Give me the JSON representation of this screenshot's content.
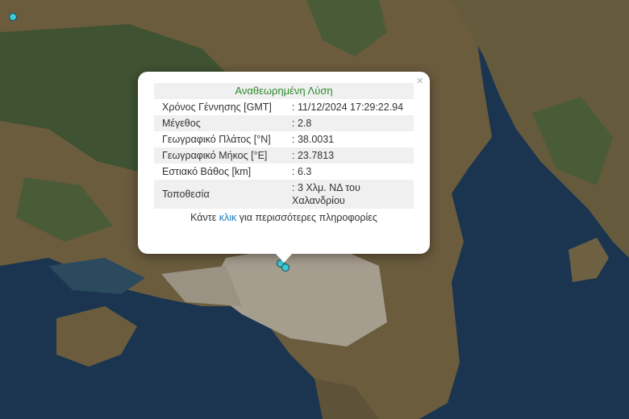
{
  "popup": {
    "heading": "Αναθεωρημένη Λύση",
    "close_label": "×",
    "rows": [
      {
        "label": "Χρόνος Γέννησης [GMT]",
        "value": ": 11/12/2024 17:29:22.94"
      },
      {
        "label": "Μέγεθος",
        "value": ": 2.8"
      },
      {
        "label": "Γεωγραφικό Πλάτος [°N]",
        "value": ": 38.0031"
      },
      {
        "label": "Γεωγραφικό Μήκος [°E]",
        "value": ": 23.7813"
      },
      {
        "label": "Εστιακό Βάθος [km]",
        "value": ": 6.3"
      },
      {
        "label": "Τοποθεσία",
        "value": ": 3 Χλμ. ΝΔ του Χαλανδρίου"
      }
    ],
    "more_prefix": "Κάντε ",
    "more_link": "κλικ",
    "more_suffix": " για περισσότερες πληροφορίες"
  },
  "colors": {
    "sea": "#1b3550",
    "land": "#6b5c3e",
    "forest": "#3f5232",
    "urban": "#a59d8e",
    "marker": "#3ec9d6",
    "heading": "#2d8a2d",
    "link": "#1a7bbf"
  }
}
